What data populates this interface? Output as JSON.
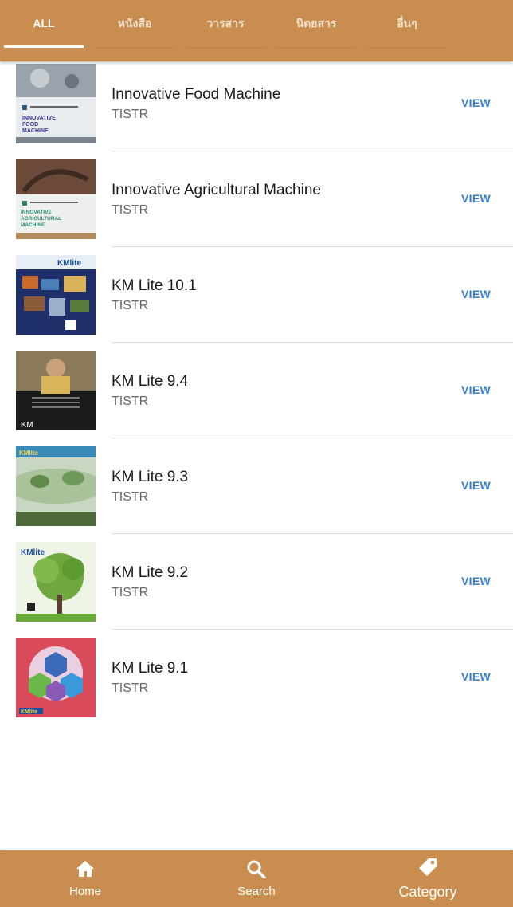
{
  "tabs": [
    {
      "label": "ALL"
    },
    {
      "label": "หนังสือ"
    },
    {
      "label": "วารสาร"
    },
    {
      "label": "นิตยสาร"
    },
    {
      "label": "อื่นๆ"
    }
  ],
  "items": [
    {
      "title": "Innovative Food Machine",
      "author": "TISTR",
      "action": "VIEW",
      "cover_text": "INNOVATIVE FOOD MACHINE"
    },
    {
      "title": "Innovative Agricultural Machine",
      "author": "TISTR",
      "action": "VIEW",
      "cover_text": "INNOVATIVE AGRICULTURAL MACHINE"
    },
    {
      "title": "KM Lite 10.1",
      "author": "TISTR",
      "action": "VIEW",
      "cover_text": "KMlite"
    },
    {
      "title": "KM Lite 9.4",
      "author": "TISTR",
      "action": "VIEW",
      "cover_text": "KM"
    },
    {
      "title": "KM Lite 9.3",
      "author": "TISTR",
      "action": "VIEW",
      "cover_text": "KMlite"
    },
    {
      "title": "KM Lite 9.2",
      "author": "TISTR",
      "action": "VIEW",
      "cover_text": "KMlite"
    },
    {
      "title": "KM Lite 9.1",
      "author": "TISTR",
      "action": "VIEW",
      "cover_text": "KMlite"
    }
  ],
  "bottom_nav": [
    {
      "label": "Home",
      "icon": "home-icon"
    },
    {
      "label": "Search",
      "icon": "search-icon"
    },
    {
      "label": "Category",
      "icon": "tag-icon"
    }
  ],
  "colors": {
    "bar": "#c98d4f",
    "action": "#3a7fd6"
  }
}
